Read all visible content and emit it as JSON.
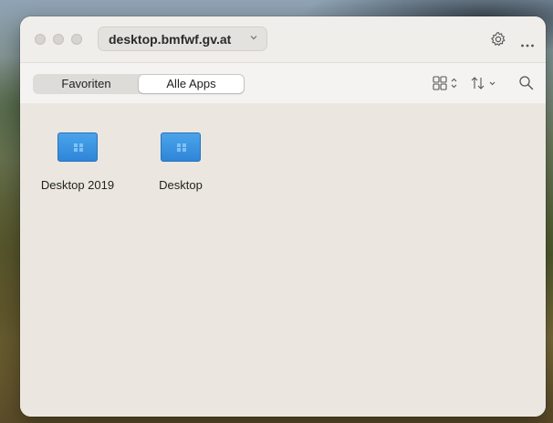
{
  "titlebar": {
    "address": "desktop.bmfwf.gv.at",
    "icons": {
      "address_dropdown": "chevron-down-icon",
      "settings": "gear-icon",
      "more": "ellipsis-icon"
    }
  },
  "toolbar": {
    "tabs": [
      {
        "label": "Favoriten",
        "selected": false
      },
      {
        "label": "Alle Apps",
        "selected": true
      }
    ],
    "icons": {
      "view": "grid-view-icon",
      "sort": "sort-arrows-icon",
      "search": "search-icon"
    }
  },
  "apps": [
    {
      "label": "Desktop 2019",
      "icon": "windows-desktop-icon"
    },
    {
      "label": "Desktop",
      "icon": "windows-desktop-icon"
    }
  ],
  "colors": {
    "app_icon": "#3a92de",
    "window_bg": "#ebe7e0"
  }
}
